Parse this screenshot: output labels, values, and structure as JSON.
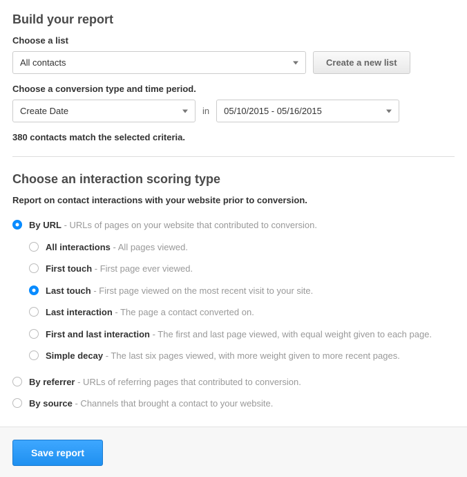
{
  "header": {
    "title": "Build your report"
  },
  "list": {
    "label": "Choose a list",
    "selected": "All contacts",
    "create_button": "Create a new list"
  },
  "conversion": {
    "label": "Choose a conversion type and time period.",
    "type_selected": "Create Date",
    "in_label": "in",
    "date_range": "05/10/2015 - 05/16/2015"
  },
  "match_text": "380 contacts match the selected criteria.",
  "scoring": {
    "title": "Choose an interaction scoring type",
    "subtitle": "Report on contact interactions with your website prior to conversion.",
    "options": [
      {
        "label": "By URL",
        "desc": " - URLs of pages on your website that contributed to conversion.",
        "selected": true,
        "sub": [
          {
            "label": "All interactions",
            "desc": " - All pages viewed.",
            "selected": false
          },
          {
            "label": "First touch",
            "desc": " - First page ever viewed.",
            "selected": false
          },
          {
            "label": "Last touch",
            "desc": " - First page viewed on the most recent visit to your site.",
            "selected": true
          },
          {
            "label": "Last interaction",
            "desc": " - The page a contact converted on.",
            "selected": false
          },
          {
            "label": "First and last interaction",
            "desc": " - The first and last page viewed, with equal weight given to each page.",
            "selected": false
          },
          {
            "label": "Simple decay",
            "desc": " - The last six pages viewed, with more weight given to more recent pages.",
            "selected": false
          }
        ]
      },
      {
        "label": "By referrer",
        "desc": " - URLs of referring pages that contributed to conversion.",
        "selected": false
      },
      {
        "label": "By source",
        "desc": " - Channels that brought a contact to your website.",
        "selected": false
      }
    ]
  },
  "footer": {
    "save_button": "Save report"
  }
}
